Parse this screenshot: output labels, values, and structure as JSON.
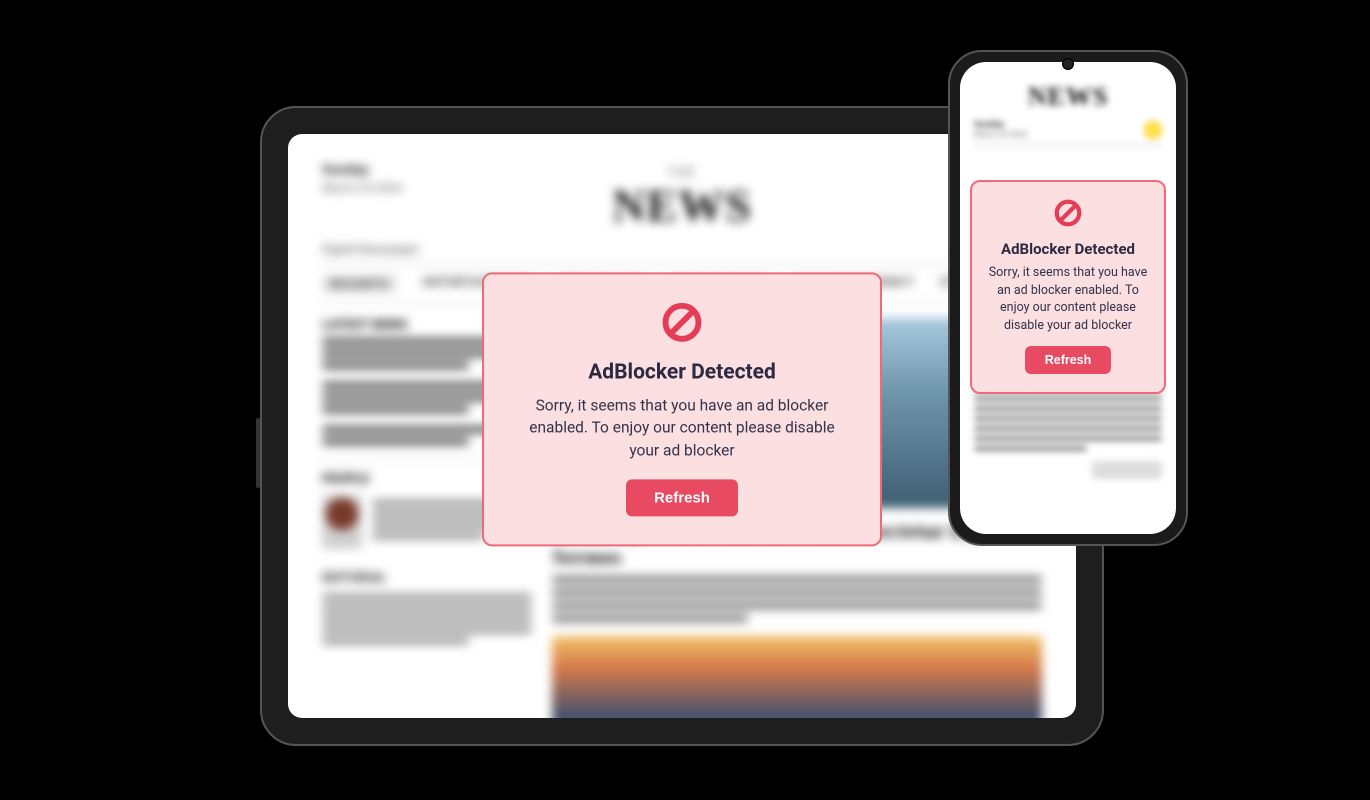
{
  "site_masthead": "NEWS",
  "modal": {
    "title": "AdBlocker Detected",
    "description": "Sorry, it seems that you have an ad blocker enabled. To enjoy our content please disable your ad blocker",
    "button_label": "Refresh",
    "icon_name": "prohibit-icon"
  },
  "colors": {
    "modal_bg": "#fcdfe0",
    "modal_border": "#ed6b78",
    "accent": "#e84a62",
    "icon": "#e43d55",
    "title_text": "#2c2a42"
  }
}
